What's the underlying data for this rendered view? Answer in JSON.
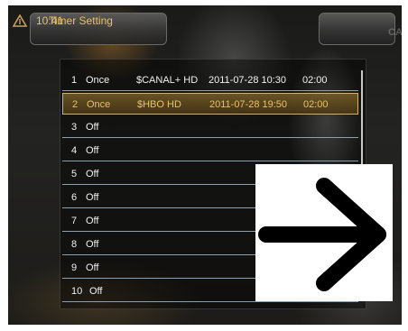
{
  "header": {
    "title": "Timer Setting",
    "time": "10:41",
    "overlay_text": "CANAL+"
  },
  "timers": [
    {
      "num": "1",
      "mode": "Once",
      "channel": "$CANAL+ HD",
      "datetime": "2011-07-28 10:30",
      "duration": "02:00",
      "selected": false
    },
    {
      "num": "2",
      "mode": "Once",
      "channel": "$HBO HD",
      "datetime": "2011-07-28 19:50",
      "duration": "02:00",
      "selected": true
    },
    {
      "num": "3",
      "mode": "Off",
      "channel": "",
      "datetime": "",
      "duration": "",
      "selected": false
    },
    {
      "num": "4",
      "mode": "Off",
      "channel": "",
      "datetime": "",
      "duration": "",
      "selected": false
    },
    {
      "num": "5",
      "mode": "Off",
      "channel": "",
      "datetime": "",
      "duration": "",
      "selected": false
    },
    {
      "num": "6",
      "mode": "Off",
      "channel": "",
      "datetime": "",
      "duration": "",
      "selected": false
    },
    {
      "num": "7",
      "mode": "Off",
      "channel": "",
      "datetime": "",
      "duration": "",
      "selected": false
    },
    {
      "num": "8",
      "mode": "Off",
      "channel": "",
      "datetime": "",
      "duration": "",
      "selected": false
    },
    {
      "num": "9",
      "mode": "Off",
      "channel": "",
      "datetime": "",
      "duration": "",
      "selected": false
    },
    {
      "num": "10",
      "mode": "Off",
      "channel": "",
      "datetime": "",
      "duration": "",
      "selected": false
    }
  ],
  "colors": {
    "accent": "#e8c06a",
    "selected_border": "#d9b253",
    "row_divider": "#8aa0b0"
  },
  "icons": {
    "logo": "brand-logo-icon",
    "overlay_arrow": "right-arrow-icon"
  }
}
